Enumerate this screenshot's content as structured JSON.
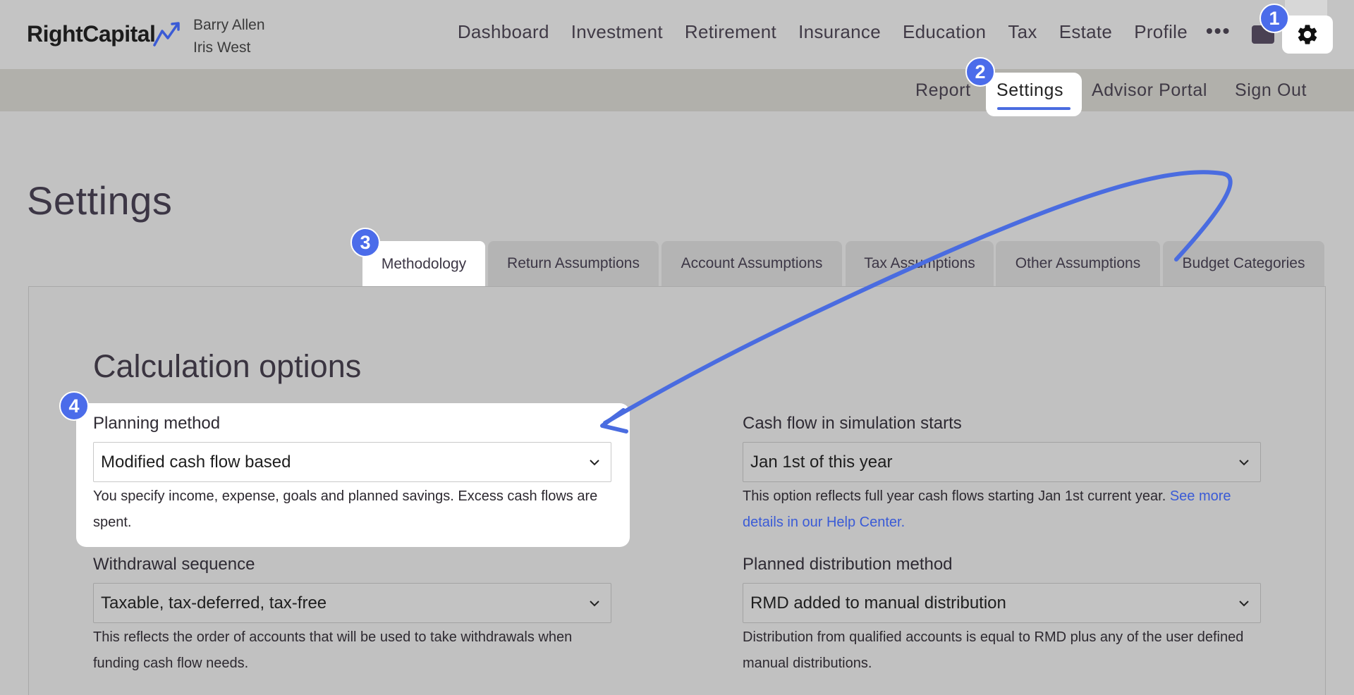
{
  "header": {
    "brand": "RightCapital",
    "client_primary": "Barry Allen",
    "client_secondary": "Iris West",
    "nav": [
      "Dashboard",
      "Investment",
      "Retirement",
      "Insurance",
      "Education",
      "Tax",
      "Estate",
      "Profile"
    ],
    "more": "•••"
  },
  "subnav": {
    "report": "Report",
    "settings": "Settings",
    "advisor_portal": "Advisor Portal",
    "sign_out": "Sign Out"
  },
  "badges": [
    "1",
    "2",
    "3",
    "4"
  ],
  "page": {
    "title": "Settings"
  },
  "tabs": [
    "Methodology",
    "Return Assumptions",
    "Account Assumptions",
    "Tax Assumptions",
    "Other Assumptions",
    "Budget Categories"
  ],
  "section": {
    "title": "Calculation options",
    "planning_method": {
      "label": "Planning method",
      "value": "Modified cash flow based",
      "help": "You specify income, expense, goals and planned savings. Excess cash flows are spent."
    },
    "cash_flow_start": {
      "label": "Cash flow in simulation starts",
      "value": "Jan 1st of this year",
      "help": "This option reflects full year cash flows starting Jan 1st current year.",
      "link": "See more details in our Help Center."
    },
    "withdrawal_sequence": {
      "label": "Withdrawal sequence",
      "value": "Taxable, tax-deferred, tax-free",
      "help": "This reflects the order of accounts that will be used to take withdrawals when funding cash flow needs."
    },
    "distribution_method": {
      "label": "Planned distribution method",
      "value": "RMD added to manual distribution",
      "help": "Distribution from qualified accounts is equal to RMD plus any of the user defined manual distributions."
    }
  },
  "colors": {
    "accent": "#4b6cea",
    "link": "#3a5bd6",
    "background": "#c2c2c2"
  }
}
